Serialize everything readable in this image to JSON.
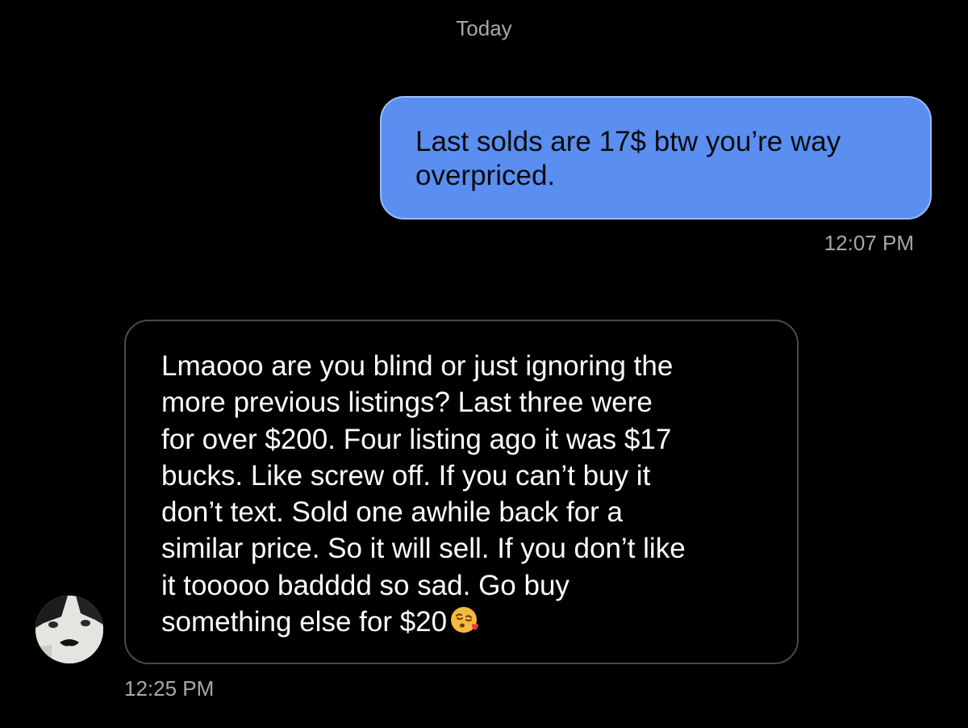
{
  "conversation": {
    "date_label": "Today",
    "messages": [
      {
        "direction": "outgoing",
        "text": "Last solds are 17$ btw you’re way overpriced.",
        "time": "12:07 PM",
        "bubble_color": "#5a8ef1"
      },
      {
        "direction": "incoming",
        "text": "Lmaooo are you blind or just ignoring the\nmore previous listings? Last three were\nfor over $200. Four listing ago it was $17\nbucks. Like screw off. If you can’t buy it\ndon’t text. Sold one awhile back for a\nsimilar price. So it will sell. If you don’t like\nit tooooo badddd so sad.  Go buy\nsomething else for $20",
        "emoji": "face-blowing-a-kiss-icon",
        "time": "12:25 PM",
        "bubble_border_color": "#4a4a4a"
      }
    ],
    "sender_avatar": "cat-avatar"
  }
}
